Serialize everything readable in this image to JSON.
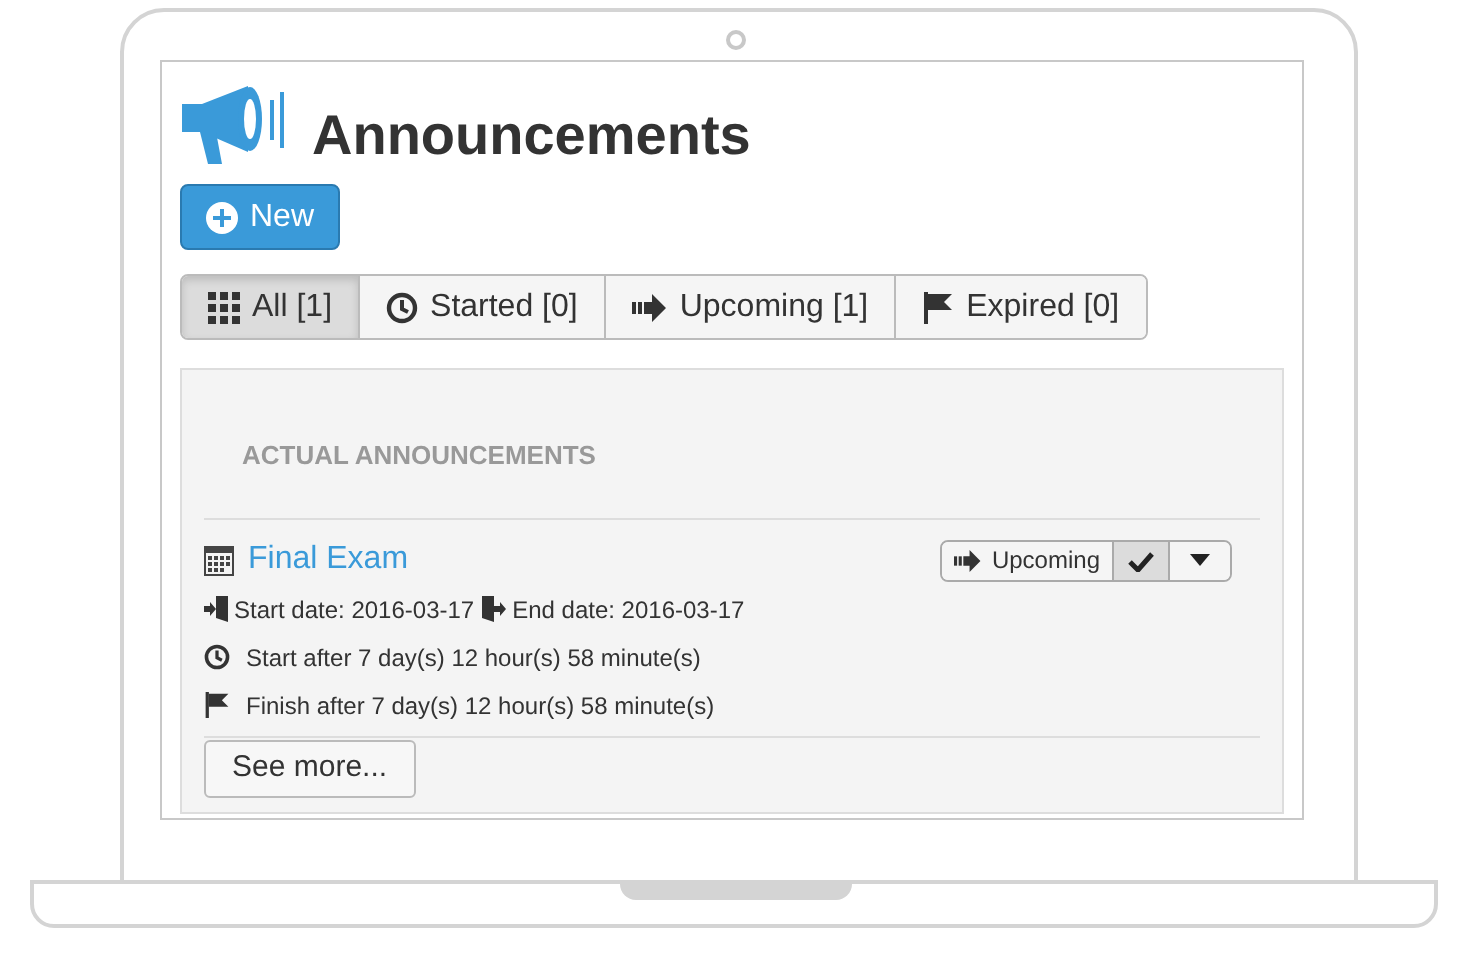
{
  "page": {
    "title": "Announcements",
    "new_button": "New"
  },
  "tabs": [
    {
      "label": "All [1]",
      "selected": true
    },
    {
      "label": "Started [0]",
      "selected": false
    },
    {
      "label": "Upcoming [1]",
      "selected": false
    },
    {
      "label": "Expired [0]",
      "selected": false
    }
  ],
  "panel": {
    "heading": "ACTUAL ANNOUNCEMENTS",
    "announcements": [
      {
        "title": "Final Exam",
        "start_date": "Start date: 2016-03-17",
        "end_date": "End date: 2016-03-17",
        "start_after": "Start after 7 day(s) 12 hour(s) 58 minute(s)",
        "finish_after": "Finish after 7 day(s) 12 hour(s) 58 minute(s)",
        "status": "Upcoming",
        "checked": true
      }
    ],
    "see_more": "See more..."
  }
}
